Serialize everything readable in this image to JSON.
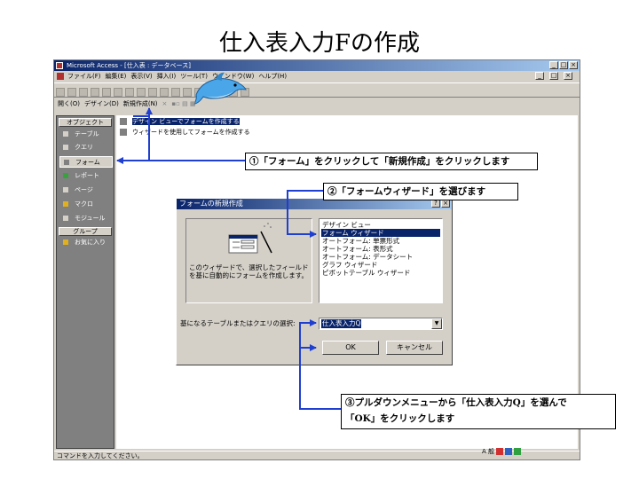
{
  "slide": {
    "title": "仕入表入力Fの作成"
  },
  "app": {
    "title": "Microsoft Access - [仕入表 : データベース]",
    "menu": [
      "ファイル(F)",
      "編集(E)",
      "表示(V)",
      "挿入(I)",
      "ツール(T)",
      "ウィンドウ(W)",
      "ヘルプ(H)"
    ],
    "db_toolbar": {
      "open_label": "開く(O)",
      "design_label": "デザイン(D)",
      "new_label": "新規作成(N)"
    },
    "sidebar": {
      "header_objects": "オブジェクト",
      "items": [
        {
          "label": "テーブル",
          "icon": "table-icon"
        },
        {
          "label": "クエリ",
          "icon": "query-icon"
        },
        {
          "label": "フォーム",
          "icon": "form-icon"
        },
        {
          "label": "レポート",
          "icon": "report-icon"
        },
        {
          "label": "ページ",
          "icon": "page-icon"
        },
        {
          "label": "マクロ",
          "icon": "macro-icon"
        },
        {
          "label": "モジュール",
          "icon": "module-icon"
        }
      ],
      "header_groups": "グループ",
      "favorites": "お気に入り"
    },
    "objects": [
      {
        "label": "デザイン ビューでフォームを作成する",
        "selected": true
      },
      {
        "label": "ウィザードを使用してフォームを作成する",
        "selected": false
      }
    ],
    "status": "コマンドを入力してください。"
  },
  "dialog": {
    "title": "フォームの新規作成",
    "description": "このウィザードで、選択したフィールドを基に自動的にフォームを作成します。",
    "methods": [
      "デザイン ビュー",
      "フォーム ウィザード",
      "オートフォーム: 単票形式",
      "オートフォーム: 表形式",
      "オートフォーム: データシート",
      "グラフ ウィザード",
      "ピボットテーブル ウィザード"
    ],
    "selected_method_index": 1,
    "table_label": "基になるテーブルまたはクエリの選択:",
    "table_value": "仕入表入力Q",
    "ok": "OK",
    "cancel": "キャンセル"
  },
  "callouts": {
    "c1": "①「フォーム」をクリックして「新規作成」をクリックします",
    "c2": "②「フォームウィザード」を選びます",
    "c3_line1": "③プルダウンメニューから「仕入表入力Q」を選んで",
    "c3_line2": "「OK」をクリックします"
  },
  "colors": {
    "accent": "#0a246a",
    "window": "#d4d0c8",
    "arrow": "#1f3fd0"
  }
}
